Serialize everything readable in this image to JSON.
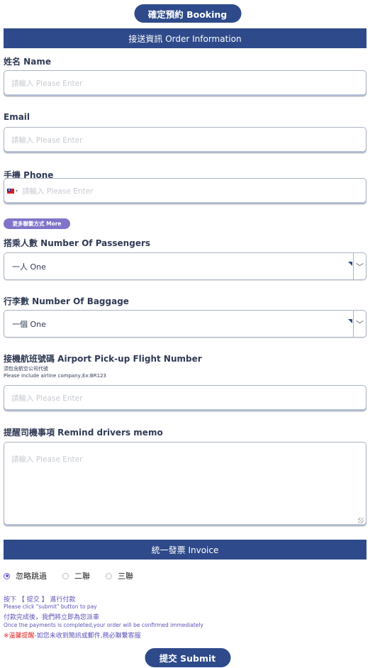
{
  "header": {
    "confirm_label": "確定預約 Booking"
  },
  "order_section": {
    "title": "接送資訊 Order Information"
  },
  "name": {
    "label": "姓名 Name",
    "placeholder": "請輸入 Please Enter"
  },
  "email": {
    "label": "Email",
    "placeholder": "請輸入 Please Enter"
  },
  "phone": {
    "label": "手機 Phone",
    "placeholder": "請輸入 Please Enter",
    "flag": "tw-flag-icon"
  },
  "more_contact": {
    "label": "更多聯繫方式 More"
  },
  "passengers": {
    "label": "搭乘人數 Number Of Passengers",
    "value": "一人 One"
  },
  "baggage": {
    "label": "行李數 Number Of Baggage",
    "value": "一個 One"
  },
  "flight": {
    "label": "接機航班號碼 Airport Pick-up Flight Number",
    "hint_zh": "須包含航空公司代號",
    "hint_en": "Please include airline company,Ex:BR123",
    "placeholder": "請輸入 Please Enter"
  },
  "memo": {
    "label": "提醒司機事項 Remind drivers memo",
    "placeholder": "請輸入 Please Enter"
  },
  "invoice": {
    "title": "統一發票 Invoice",
    "options": [
      "忽略跳過",
      "二聯",
      "三聯"
    ],
    "selected": "忽略跳過"
  },
  "notes": {
    "line1": "按下 【 提交 】 進行付款",
    "line2": "Please click \"submit\" button to pay",
    "line3": "付款完成後，我們將立即為您派車",
    "line4": "Once the payments is completed,your order will be confirmed immediately",
    "warning_prefix": "※溫馨提醒",
    "warning_text": "-如您未收到簡訊或郵件,務必聯繫客服"
  },
  "submit": {
    "label": "提交 Submit"
  },
  "colors": {
    "primary": "#2e4a8a",
    "accent": "#7f74c9",
    "warning": "#e02020"
  }
}
